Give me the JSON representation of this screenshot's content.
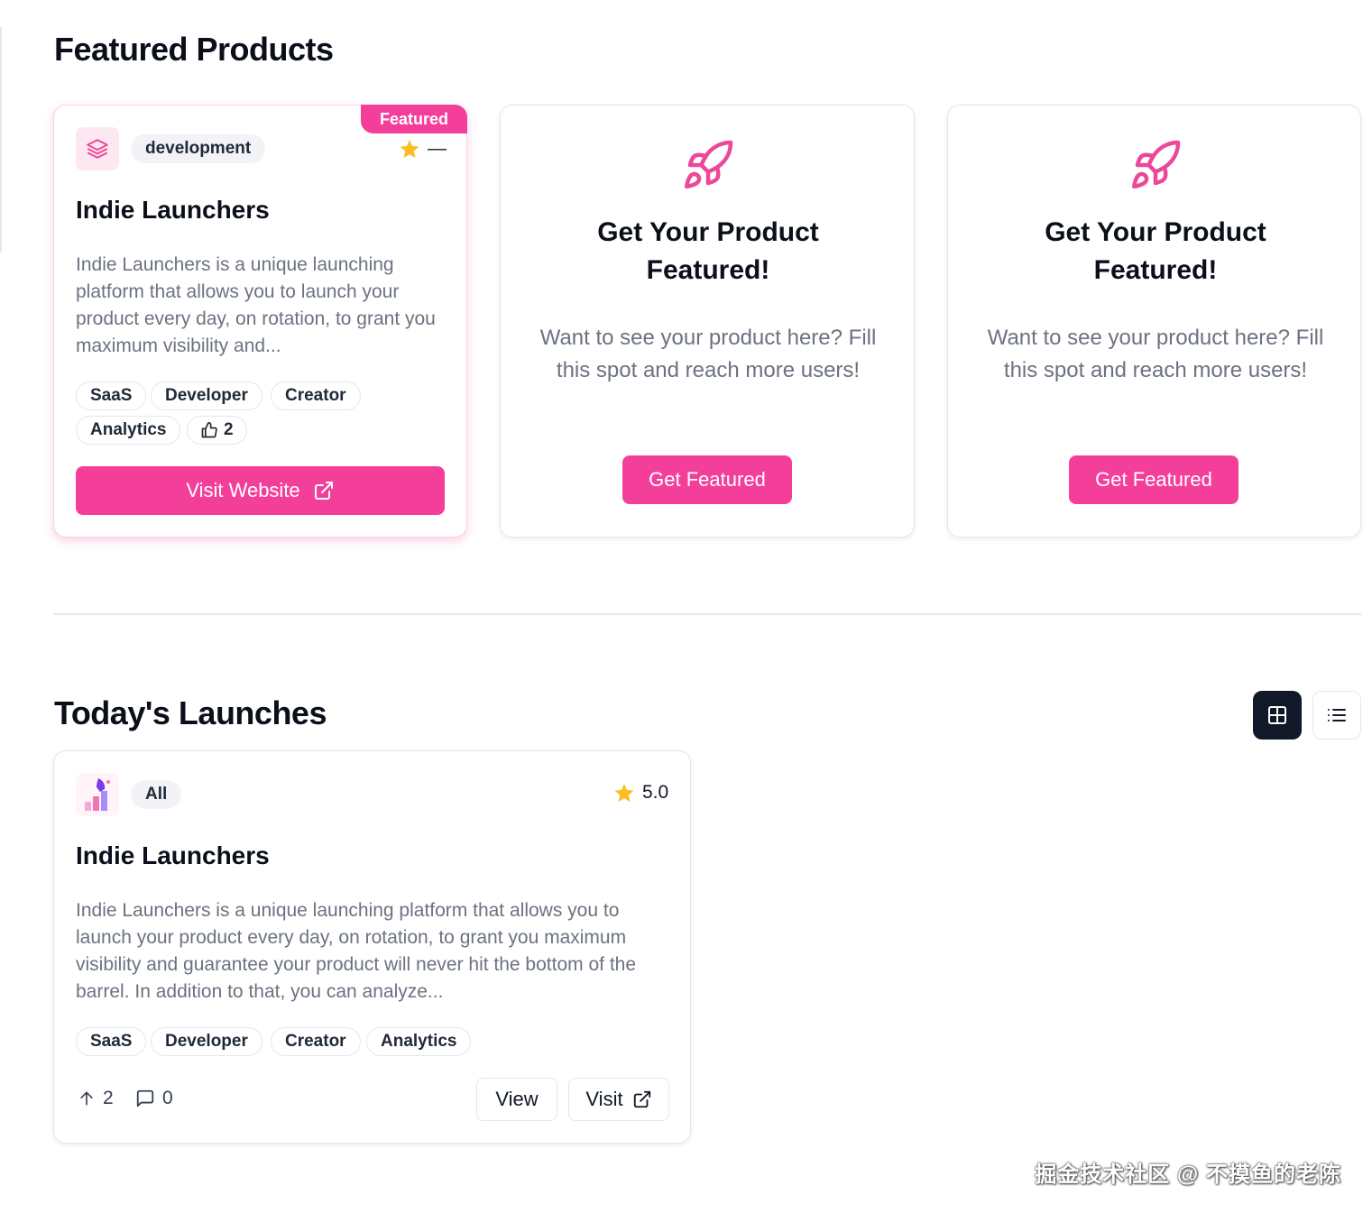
{
  "featured_section": {
    "title": "Featured Products",
    "card": {
      "ribbon": "Featured",
      "category": "development",
      "rating_text": "—",
      "title": "Indie Launchers",
      "description": "Indie Launchers is a unique launching platform that allows you to launch your product every day, on rotation, to grant you maximum visibility and...",
      "tags": [
        "SaaS",
        "Developer",
        "Creator",
        "Analytics"
      ],
      "likes": "2",
      "visit_label": "Visit Website"
    },
    "promos": [
      {
        "title": "Get Your Product Featured!",
        "description": "Want to see your product here? Fill this spot and reach more users!",
        "button": "Get Featured"
      },
      {
        "title": "Get Your Product Featured!",
        "description": "Want to see your product here? Fill this spot and reach more users!",
        "button": "Get Featured"
      }
    ]
  },
  "launches_section": {
    "title": "Today's Launches",
    "view_modes": [
      "grid-icon",
      "list-icon"
    ],
    "card": {
      "category": "All",
      "rating": "5.0",
      "title": "Indie Launchers",
      "description": "Indie Launchers is a unique launching platform that allows you to launch your product every day, on rotation, to grant you maximum visibility and guarantee your product will never hit the bottom of the barrel. In addition to that, you can analyze...",
      "tags": [
        "SaaS",
        "Developer",
        "Creator",
        "Analytics"
      ],
      "upvotes": "2",
      "comments": "0",
      "view_label": "View",
      "visit_label": "Visit"
    }
  },
  "watermark": "掘金技术社区 @ 不摸鱼的老陈",
  "colors": {
    "accent": "#f43f9a",
    "dark": "#111827",
    "star": "#fbbf24"
  }
}
